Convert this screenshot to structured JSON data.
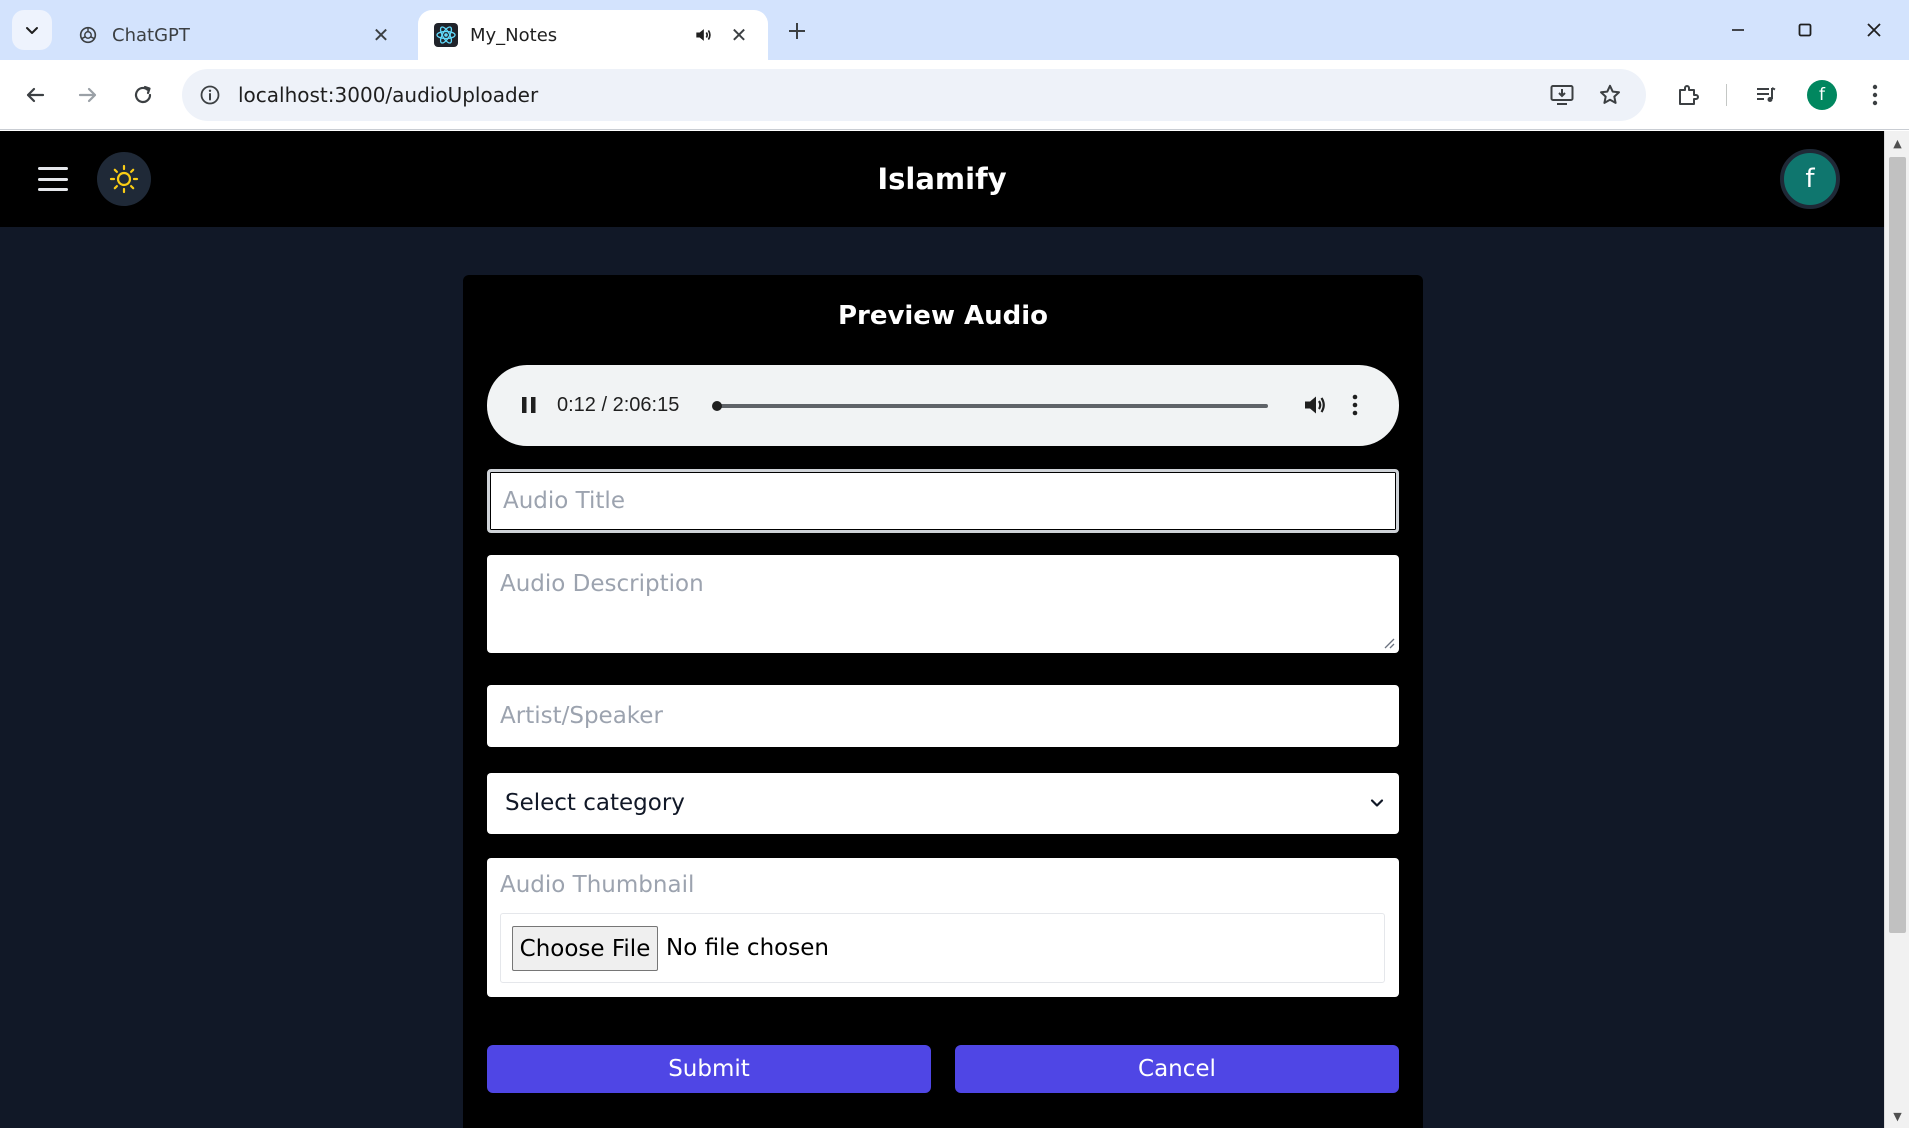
{
  "browser": {
    "tabs": [
      {
        "title": "ChatGPT",
        "active": false
      },
      {
        "title": "My_Notes",
        "active": true
      }
    ],
    "url": "localhost:3000/audioUploader"
  },
  "header": {
    "brand": "Islamify",
    "avatar_initial": "f"
  },
  "profile": {
    "initial": "f"
  },
  "form": {
    "title": "Preview Audio",
    "player": {
      "time": "0:12 / 2:06:15",
      "progress": 0.0016
    },
    "audio_title_placeholder": "Audio Title",
    "audio_description_placeholder": "Audio Description",
    "artist_placeholder": "Artist/Speaker",
    "category_selected": "Select category",
    "thumbnail_label": "Audio Thumbnail",
    "file_button_label": "Choose File",
    "file_status": "No file chosen",
    "submit_label": "Submit",
    "cancel_label": "Cancel"
  },
  "colors": {
    "page_bg": "#111827",
    "card_bg": "#000000",
    "button": "#4f46e5",
    "avatar": "#0f766e",
    "sun": "#facc15"
  }
}
